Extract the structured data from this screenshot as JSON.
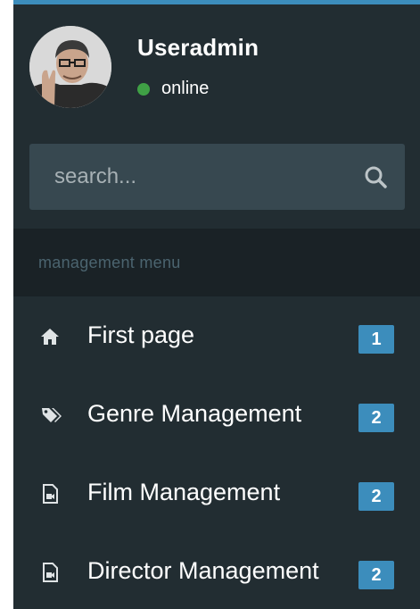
{
  "user": {
    "name": "Useradmin",
    "status": "online",
    "status_color": "#3fa045"
  },
  "search": {
    "placeholder": "search..."
  },
  "menu": {
    "header": "management menu",
    "items": [
      {
        "label": "First page",
        "icon": "home-icon",
        "badge": "1"
      },
      {
        "label": "Genre Management",
        "icon": "tags-icon",
        "badge": "2"
      },
      {
        "label": "Film Management",
        "icon": "file-video-icon",
        "badge": "2"
      },
      {
        "label": "Director Management",
        "icon": "file-video-icon",
        "badge": "2"
      }
    ]
  },
  "colors": {
    "sidebar_bg": "#222d32",
    "search_bg": "#374850",
    "header_bg": "#1a2226",
    "accent": "#3c8dbc"
  }
}
